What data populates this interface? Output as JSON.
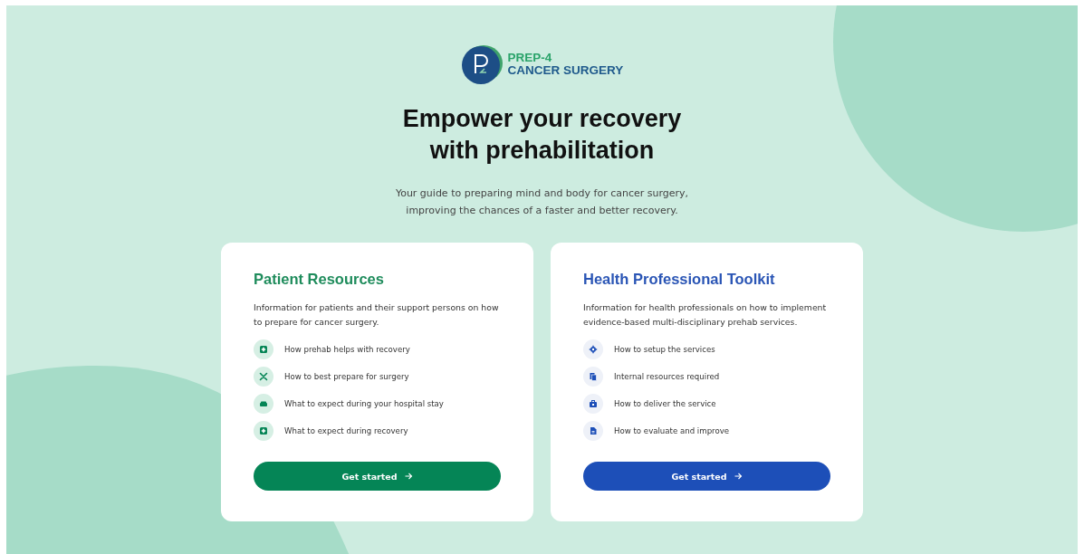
{
  "logo": {
    "line_1": "PREP-4",
    "line_2": "CANCER SURGERY"
  },
  "hero": {
    "title_line_1": "Empower your recovery",
    "title_line_2": "with prehabilitation",
    "subtitle_line_1": "Your guide to preparing mind and body for cancer surgery,",
    "subtitle_line_2": "improving the chances of a faster and better recovery."
  },
  "cards": [
    {
      "kind": "patient",
      "title": "Patient Resources",
      "description": "Information for patients and their support persons on how to prepare for cancer surgery.",
      "items": [
        "How prehab helps with recovery",
        "How to best prepare for surgery",
        "What to expect during your hospital stay",
        "What to expect during recovery"
      ],
      "button": "Get started"
    },
    {
      "kind": "professional",
      "title": "Health Professional Toolkit",
      "description": "Information for health professionals on how to implement evidence-based multi-disciplinary prehab services.",
      "items": [
        "How to setup the services",
        "Internal resources required",
        "How to deliver the service",
        "How to evaluate and improve"
      ],
      "button": "Get started"
    }
  ]
}
